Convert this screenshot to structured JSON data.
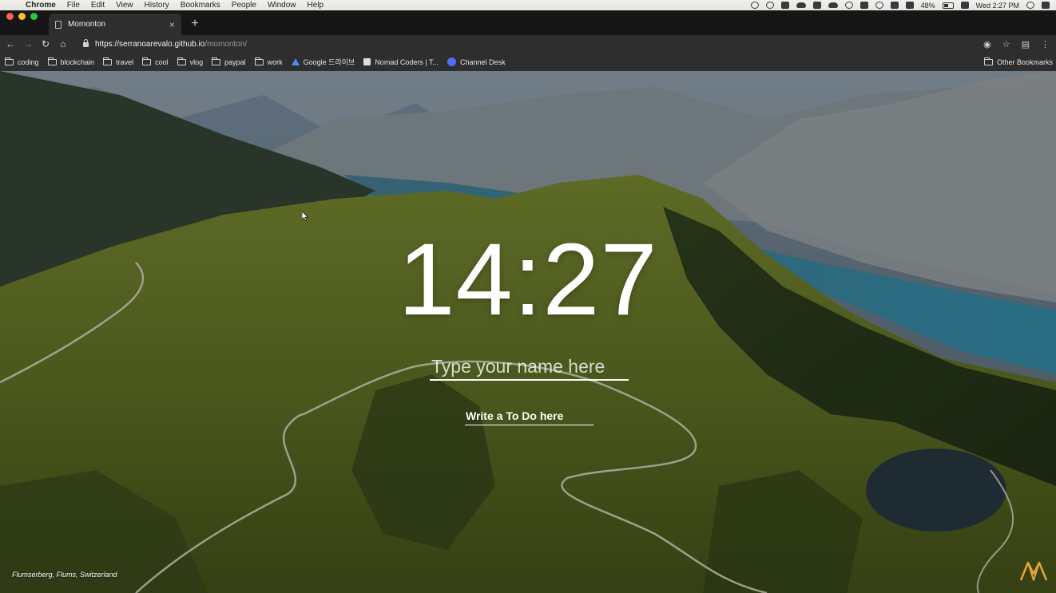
{
  "menubar": {
    "app": "Chrome",
    "items": [
      "File",
      "Edit",
      "View",
      "History",
      "Bookmarks",
      "People",
      "Window",
      "Help"
    ],
    "battery": "48%",
    "clock": "Wed 2:27 PM"
  },
  "tab": {
    "title": "Momonton",
    "close": "×",
    "new_tab": "+"
  },
  "toolbar": {
    "url_host": "https://serranoarevalo.github.io",
    "url_path": "/momonton/"
  },
  "bookmarks": {
    "items": [
      "coding",
      "blockchain",
      "travel",
      "cool",
      "vlog",
      "paypal",
      "work",
      "Google 드라이브",
      "Nomad Coders | T...",
      "Channel Desk"
    ],
    "other": "Other Bookmarks"
  },
  "page": {
    "time": "14:27",
    "name_placeholder": "Type your name here",
    "todo_placeholder": "Write a To Do here",
    "location": "Flumserberg, Flums, Switzerland"
  },
  "colors": {
    "tab_bg": "#2e2e2e",
    "strip_bg": "#161616",
    "accent_logo": "#e8a23a"
  }
}
